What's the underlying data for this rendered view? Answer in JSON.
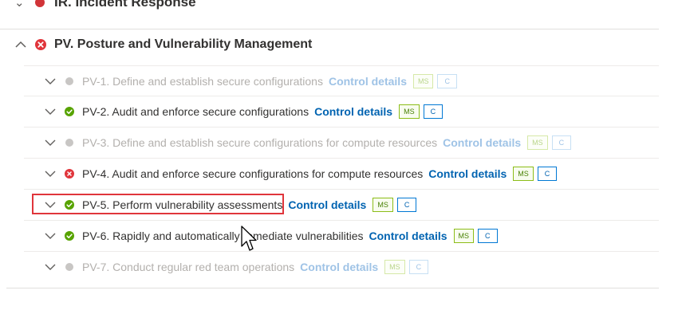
{
  "previous_group": {
    "title": "IR. Incident Response",
    "status": "failed"
  },
  "group": {
    "title": "PV. Posture and Vulnerability Management",
    "status": "failed",
    "expanded": true
  },
  "controls": [
    {
      "label": "PV-1. Define and establish secure configurations",
      "status": "not-applicable",
      "link": "Control details",
      "badges": [
        "MS",
        "C"
      ]
    },
    {
      "label": "PV-2. Audit and enforce secure configurations",
      "status": "passed",
      "link": "Control details",
      "badges": [
        "MS",
        "C"
      ]
    },
    {
      "label": "PV-3. Define and establish secure configurations for compute resources",
      "status": "not-applicable",
      "link": "Control details",
      "badges": [
        "MS",
        "C"
      ]
    },
    {
      "label": "PV-4. Audit and enforce secure configurations for compute resources",
      "status": "failed",
      "link": "Control details",
      "badges": [
        "MS",
        "C"
      ]
    },
    {
      "label": "PV-5. Perform vulnerability assessments",
      "status": "passed",
      "link": "Control details",
      "badges": [
        "MS",
        "C"
      ],
      "highlighted": true
    },
    {
      "label": "PV-6. Rapidly and automatically remediate vulnerabilities",
      "status": "passed",
      "link": "Control details",
      "badges": [
        "MS",
        "C"
      ]
    },
    {
      "label": "PV-7. Conduct regular red team operations",
      "status": "not-applicable",
      "link": "Control details",
      "badges": [
        "MS",
        "C"
      ]
    }
  ],
  "colors": {
    "failed": "#e0353b",
    "passed": "#57a300",
    "not_applicable": "#c8c6c4",
    "link": "#0063b1",
    "highlight": "#e0353b"
  },
  "icons": {
    "expand": "chevron-down-icon",
    "collapse": "chevron-up-icon",
    "failed": "error-circle-icon",
    "passed": "success-circle-icon",
    "not_applicable": "gray-dot-icon"
  }
}
